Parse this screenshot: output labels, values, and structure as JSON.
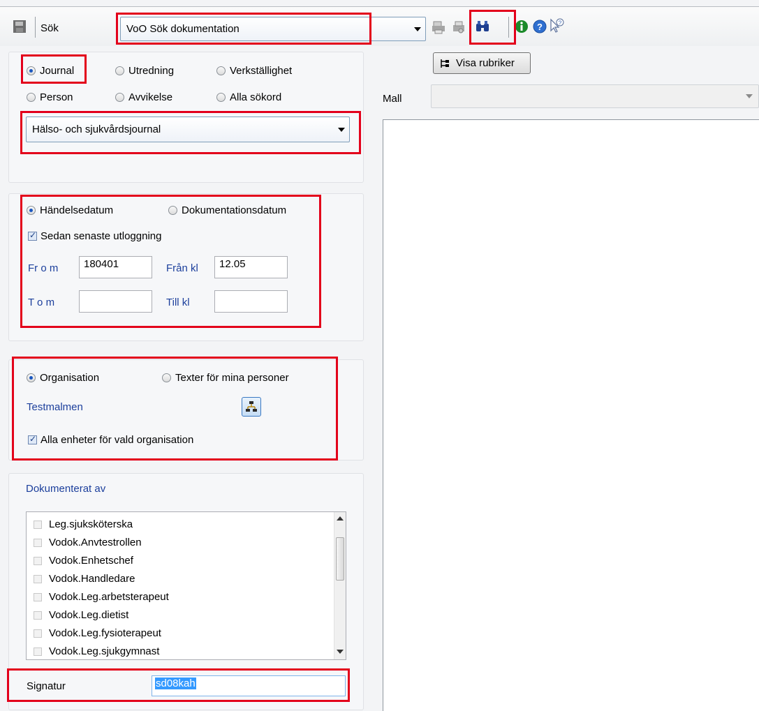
{
  "toolbar": {
    "search_label": "Sök",
    "mode_value": "VoO Sök dokumentation"
  },
  "doc_type": {
    "options": [
      "Journal",
      "Utredning",
      "Verkställighet",
      "Person",
      "Avvikelse",
      "Alla sökord"
    ],
    "selected": "Journal",
    "journal_select": "Hälso- och sjukvårdsjournal"
  },
  "dates": {
    "handelse_label": "Händelsedatum",
    "dokumentation_label": "Dokumentationsdatum",
    "since_label": "Sedan senaste utloggning",
    "from_label": "Fr o m",
    "from_value": "180401",
    "from_time_label": "Från kl",
    "from_time_value": "12.05",
    "to_label": "T o m",
    "to_value": "",
    "to_time_label": "Till kl",
    "to_time_value": ""
  },
  "org": {
    "org_label": "Organisation",
    "texts_label": "Texter för mina personer",
    "org_name": "Testmalmen",
    "all_units_label": "Alla enheter för vald organisation"
  },
  "documented_by": {
    "title": "Dokumenterat av",
    "items": [
      "Leg.sjuksköterska",
      "Vodok.Anvtestrollen",
      "Vodok.Enhetschef",
      "Vodok.Handledare",
      "Vodok.Leg.arbetsterapeut",
      "Vodok.Leg.dietist",
      "Vodok.Leg.fysioterapeut",
      "Vodok.Leg.sjukgymnast"
    ]
  },
  "signature": {
    "label": "Signatur",
    "value": "sd08kah"
  },
  "right": {
    "visa_button": "Visa rubriker",
    "mall_label": "Mall",
    "mall_value": ""
  },
  "colors": {
    "highlight": "#e3001b",
    "label_blue": "#1c3f9c"
  }
}
